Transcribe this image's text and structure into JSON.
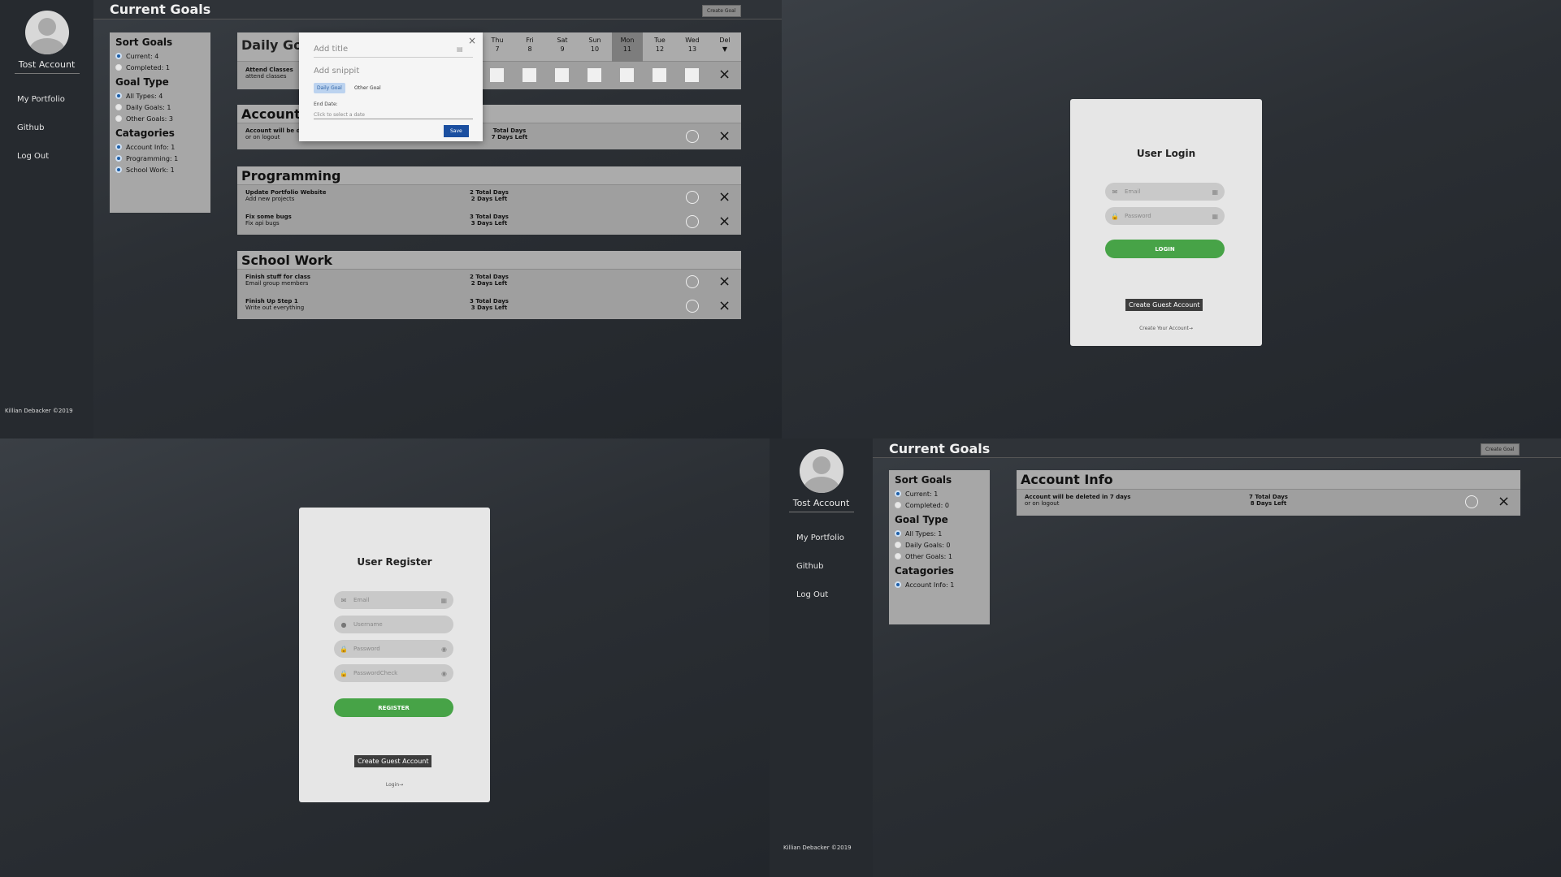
{
  "common": {
    "account_name": "Tost Account",
    "nav": [
      "My Portfolio",
      "Github",
      "Log Out"
    ],
    "footer": "Killian Debacker ©2019",
    "page_title": "Current Goals",
    "create_goal": "Create Goal",
    "sort_goals": "Sort Goals",
    "goal_type": "Goal Type",
    "categories": "Catagories",
    "close_icon": "×"
  },
  "q1": {
    "sort": [
      "Current: 4",
      "Completed: 1"
    ],
    "types": [
      "All Types: 4",
      "Daily Goals: 1",
      "Other Goals: 3"
    ],
    "cats": [
      "Account Info: 1",
      "Programming: 1",
      "School Work: 1"
    ],
    "daily": {
      "title": "Daily Goo",
      "days": [
        {
          "d": "Thu",
          "n": "7"
        },
        {
          "d": "Fri",
          "n": "8"
        },
        {
          "d": "Sat",
          "n": "9"
        },
        {
          "d": "Sun",
          "n": "10"
        },
        {
          "d": "Mon",
          "n": "11"
        },
        {
          "d": "Tue",
          "n": "12"
        },
        {
          "d": "Wed",
          "n": "13"
        },
        {
          "d": "Del",
          "n": "▼"
        }
      ],
      "row_title": "Attend Classes",
      "row_snip": "attend classes"
    },
    "account": {
      "title": "Account",
      "rows": [
        {
          "t": "Account will be d",
          "s": "or on logout",
          "total": "Total Days",
          "left": "7 Days Left"
        }
      ]
    },
    "programming": {
      "title": "Programming",
      "rows": [
        {
          "t": "Update Portfolio Website",
          "s": "Add new projects",
          "total": "2 Total Days",
          "left": "2 Days Left"
        },
        {
          "t": "Fix some bugs",
          "s": "Fix api bugs",
          "total": "3 Total Days",
          "left": "3 Days Left"
        }
      ]
    },
    "school": {
      "title": "School Work",
      "rows": [
        {
          "t": "Finish stuff for class",
          "s": "Email group members",
          "total": "2 Total Days",
          "left": "2 Days Left"
        },
        {
          "t": "Finish Up Step 1",
          "s": "Write out everything",
          "total": "3 Total Days",
          "left": "3 Days Left"
        }
      ]
    },
    "modal": {
      "title_placeholder": "Add title",
      "snippet_placeholder": "Add snippit",
      "tab_daily": "Daily Goal",
      "tab_other": "Other Goal",
      "end_label": "End Date:",
      "date_placeholder": "Click to select a date",
      "save": "Save"
    }
  },
  "login": {
    "title": "User Login",
    "email": "Email",
    "password": "Password",
    "button": "LOGIN",
    "guest": "Create Guest Account",
    "link": "Create Your Account→"
  },
  "register": {
    "title": "User Register",
    "email": "Email",
    "username": "Username",
    "password": "Password",
    "password_check": "PasswordCheck",
    "button": "REGISTER",
    "guest": "Create Guest Account",
    "link": "Login→"
  },
  "q4": {
    "sort": [
      "Current: 1",
      "Completed: 0"
    ],
    "types": [
      "All Types: 1",
      "Daily Goals: 0",
      "Other Goals: 1"
    ],
    "cats": [
      "Account Info: 1"
    ],
    "account": {
      "title": "Account Info",
      "t": "Account will be deleted in 7 days",
      "s": "or on logout",
      "total": "7 Total Days",
      "left": "8 Days Left"
    }
  },
  "colors": {
    "accent_green": "#47a347",
    "radio_blue": "#1d5fa8",
    "save_blue": "#1b4fa0"
  }
}
